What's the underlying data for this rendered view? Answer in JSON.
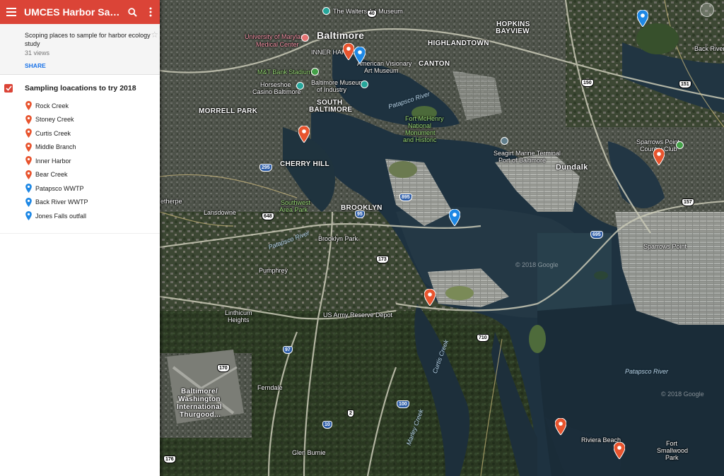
{
  "header": {
    "title": "UMCES Harbor Samplin...",
    "menu_icon": "menu-icon",
    "search_icon": "search-icon",
    "more_icon": "more-vert-icon",
    "color": "#db4437"
  },
  "description": {
    "text": "Scoping places to sample for harbor ecology study",
    "views": "31 views",
    "share": "SHARE"
  },
  "layer": {
    "title": "Sampling loacations to try 2018",
    "checked": true,
    "items": [
      {
        "label": "Rock Creek",
        "color": "#e8542e"
      },
      {
        "label": "Stoney Creek",
        "color": "#e8542e"
      },
      {
        "label": "Curtis Creek",
        "color": "#e8542e"
      },
      {
        "label": "Middle Branch",
        "color": "#e8542e"
      },
      {
        "label": "Inner Harbor",
        "color": "#e8542e"
      },
      {
        "label": "Bear Creek",
        "color": "#e8542e"
      },
      {
        "label": "Patapsco WWTP",
        "color": "#1e88e5"
      },
      {
        "label": "Back River WWTP",
        "color": "#1e88e5"
      },
      {
        "label": "Jones Falls outfall",
        "color": "#1e88e5"
      }
    ]
  },
  "map": {
    "labels": {
      "walters": "The Walters Art Museum",
      "umd": "University of Maryland",
      "umd2": "Medical Center",
      "baltimore": "Baltimore",
      "innerharbor": "INNER HARBOR",
      "avam": "American Visionary",
      "avam2": "Art Museum",
      "mt": "M&T Bank Stadium",
      "horseshoe": "Horseshoe",
      "horseshoe2": "Casino Baltimore",
      "bmi": "Baltimore Museum",
      "bmi2": "of Industry",
      "canton": "CANTON",
      "highlandtown": "HIGHLANDTOWN",
      "hopkins": "HOPKINS",
      "hopkins2": "BAYVIEW",
      "morrell": "MORRELL PARK",
      "southbalt": "SOUTH",
      "southbalt2": "BALTIMORE",
      "patapscoriverlbl": "Patapsco River",
      "fortmchenry": "Fort McHenry",
      "fortmchenry2": "National",
      "fortmchenry3": "Monument",
      "fortmchenry4": "and Historic",
      "seagirt": "Seagirt Marine Terminal",
      "seagirt2": "Port of Baltimore",
      "dundalk": "Dundalk",
      "sparrowspointcc": "Sparrows Point",
      "sparrowspointcc2": "Country Club",
      "cherryhill": "CHERRY HILL",
      "southwestarea": "Southwest",
      "southwestarea2": "Area Park",
      "brooklyn": "BROOKLYN",
      "brooklynpark": "Brooklyn Park",
      "lansdowne": "Lansdowne",
      "arbutus": "etherpe",
      "patapscoriver2": "Patapsco River",
      "pumphrey": "Pumphrey",
      "linthicum": "Linthicum",
      "linthicum2": "Heights",
      "usarmy": "US Army Reserve Depot",
      "sparrowspoint": "Sparrows Point",
      "patapscoriver3": "Patapsco River",
      "curtiscreek": "Curtis Creek",
      "marleycreek": "Marley Creek",
      "ferndale": "Ferndale",
      "bwi": "Baltimore/",
      "bwi2": "Washington",
      "bwi3": "International",
      "bwi4": "Thurgood...",
      "riviera": "Riviera Beach",
      "fortsmallwood": "Fort",
      "fortsmallwood2": "Smallwood",
      "fortsmallwood3": "Park",
      "glenburnie": "Glen Burnie",
      "backriver": "Back River",
      "copyright1": "© 2018 Google",
      "copyright2": "© 2018 Google",
      "blackcreek": "Black River"
    },
    "highways": [
      "695",
      "895",
      "95",
      "295",
      "97",
      "648",
      "40",
      "150",
      "151",
      "157",
      "2",
      "170",
      "176",
      "710",
      "100",
      "173",
      "10"
    ]
  }
}
